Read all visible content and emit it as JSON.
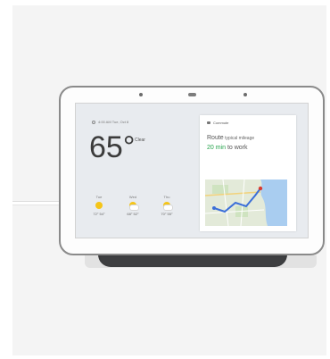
{
  "screen": {
    "status": "4:00 AM  Tue, Oct 8",
    "temperature": "65°",
    "condition": "Clear",
    "forecast": [
      {
        "day": "Tue",
        "icon": "sun-icon",
        "temps": "72° 54°"
      },
      {
        "day": "Wed",
        "icon": "partly-cloudy-icon",
        "temps": "68° 52°"
      },
      {
        "day": "Thu",
        "icon": "partly-cloudy-icon",
        "temps": "70° 55°"
      }
    ],
    "commute": {
      "heading": "Commute",
      "label": "Route",
      "detail": "  typical mileage",
      "eta_value": "20 min",
      "eta_suffix": " to work"
    }
  },
  "colors": {
    "eta_green": "#24a24a",
    "sun_yellow": "#f5c518",
    "route_blue": "#3b6fd8"
  }
}
